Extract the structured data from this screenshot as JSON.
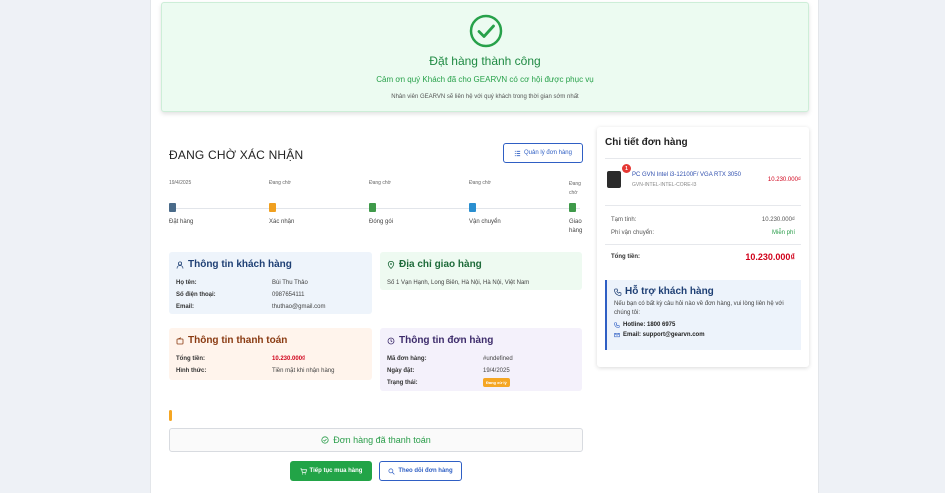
{
  "success": {
    "title": "Đặt hàng thành công",
    "subtitle": "Cảm ơn quý Khách đã cho GEARVN có cơ hội được phục vụ",
    "note": "Nhân viên GEARVN sẽ liên hệ với quý khách trong thời gian sớm nhất"
  },
  "status": {
    "title": "ĐANG CHỜ XÁC NHẬN",
    "manage_button": "Quản lý đơn hàng"
  },
  "timeline": [
    {
      "date": "19/4/2025",
      "label": "Đặt hàng",
      "color": "#4a6b8a"
    },
    {
      "date": "Đang chờ",
      "label": "Xác nhận",
      "color": "#f0a020"
    },
    {
      "date": "Đang chờ",
      "label": "Đóng gói",
      "color": "#3f9a4a"
    },
    {
      "date": "Đang chờ",
      "label": "Vận chuyển",
      "color": "#2a8fd0"
    },
    {
      "date": "Đang chờ",
      "label": "Giao hàng",
      "color": "#3f9a4a"
    }
  ],
  "customer": {
    "title": "Thông tin khách hàng",
    "name_label": "Họ tên:",
    "name": "Bùi Thu Thảo",
    "phone_label": "Số điện thoại:",
    "phone": "0987654111",
    "email_label": "Email:",
    "email": "thuthao@gmail.com"
  },
  "address": {
    "title": "Địa chỉ giao hàng",
    "value": "Số 1 Vạn Hạnh, Long Biên, Hà Nội, Hà Nội, Việt Nam"
  },
  "payment": {
    "title": "Thông tin thanh toán",
    "total_label": "Tổng tiền:",
    "total": "10.230.000₫",
    "method_label": "Hình thức:",
    "method": "Tiền mặt khi nhận hàng"
  },
  "order_info": {
    "title": "Thông tin đơn hàng",
    "code_label": "Mã đơn hàng:",
    "code": "#undefined",
    "date_label": "Ngày đặt:",
    "date": "19/4/2025",
    "status_label": "Trạng thái:",
    "status": "Đang xử lý"
  },
  "paid_banner": "Đơn hàng đã thanh toán",
  "buttons": {
    "continue": "Tiếp tục mua hàng",
    "track": "Theo dõi đơn hàng"
  },
  "detail": {
    "title": "Chi tiết đơn hàng",
    "product_qty": "1",
    "product_name": "PC GVN Intel i3-12100F/ VGA RTX 3050",
    "product_sku": "GVN-INTEL-INTEL-CORE-I3",
    "product_price": "10.230.000₫",
    "subtotal_label": "Tạm tính:",
    "subtotal": "10.230.000₫",
    "shipping_label": "Phí vận chuyển:",
    "shipping": "Miễn phí",
    "total_label": "Tổng tiền:",
    "total": "10.230.000₫"
  },
  "support": {
    "title": "Hỗ trợ khách hàng",
    "desc": "Nếu bạn có bất kỳ câu hỏi nào về đơn hàng, vui lòng liên hệ với chúng tôi:",
    "hotline": "Hotline: 1800 6975",
    "email": "Email: support@gearvn.com"
  }
}
